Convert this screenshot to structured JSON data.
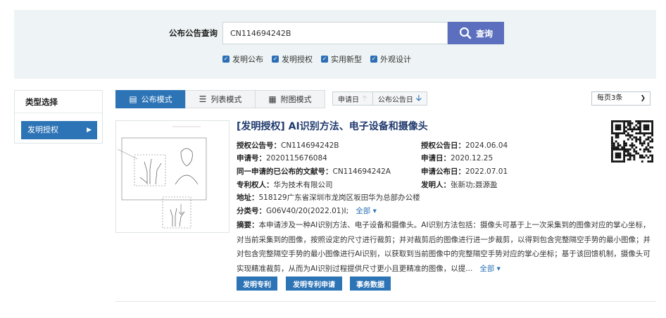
{
  "search": {
    "label": "公布公告查询",
    "value": "CN114694242B",
    "button_label": "查询",
    "filters": [
      {
        "label": "发明公布",
        "checked": true
      },
      {
        "label": "发明授权",
        "checked": true
      },
      {
        "label": "实用新型",
        "checked": true
      },
      {
        "label": "外观设计",
        "checked": true
      }
    ]
  },
  "sidebar": {
    "title": "类型选择",
    "items": [
      {
        "label": "发明授权",
        "active": true
      }
    ]
  },
  "view_tabs": [
    {
      "label": "公布模式",
      "icon": "list-detail-icon",
      "active": true
    },
    {
      "label": "列表模式",
      "icon": "list-icon",
      "active": false
    },
    {
      "label": "附图模式",
      "icon": "grid-icon",
      "active": false
    }
  ],
  "sort": [
    {
      "label": "申请日",
      "direction": "up",
      "active": false
    },
    {
      "label": "公布公告日",
      "direction": "down",
      "active": true
    }
  ],
  "per_page": {
    "value": "每页3条"
  },
  "result": {
    "title": "[发明授权] AI识别方法、电子设备和摄像头",
    "fields": {
      "grant_pub_no": {
        "label": "授权公告号：",
        "value": "CN114694242B"
      },
      "grant_pub_date": {
        "label": "授权公告日：",
        "value": "2024.06.04"
      },
      "app_no": {
        "label": "申请号：",
        "value": "2020115676084"
      },
      "app_date": {
        "label": "申请日：",
        "value": "2020.12.25"
      },
      "same_app": {
        "label": "同一申请的已公布的文献号：",
        "value": "CN114694242A"
      },
      "app_pub_date": {
        "label": "申请公布日：",
        "value": "2022.07.01"
      },
      "patentee": {
        "label": "专利权人：",
        "value": "华为技术有限公司"
      },
      "inventor": {
        "label": "发明人：",
        "value": "张新功;聂源盈"
      },
      "address": {
        "label": "地址：",
        "value": "518129广东省深圳市龙岗区坂田华为总部办公楼"
      },
      "classification": {
        "label": "分类号：",
        "value": "G06V40/20(2022.01)I;"
      }
    },
    "classification_more": "全部",
    "abstract_label": "摘要：",
    "abstract": "本申请涉及一种AI识别方法、电子设备和摄像头。AI识别方法包括：摄像头可基于上一次采集到的图像对应的掌心坐标，对当前采集到的图像，按照设定的尺寸进行裁剪；并对裁剪后的图像进行进一步裁剪，以得到包含完整隔空手势的最小图像；并对包含完整隔空手势的最小图像进行AI识别，以获取到当前图像中的完整隔空手势对应的掌心坐标；基于该回馈机制，摄像头可实现精准裁剪，从而为AI识别过程提供尺寸更小且更精准的图像，以提...",
    "abstract_more": "全部",
    "actions": [
      "发明专利",
      "发明专利申请",
      "事务数据"
    ]
  },
  "colors": {
    "primary": "#2d74b6",
    "search_button": "#5b6fbe",
    "panel_bg": "#eef4f5",
    "title": "#203a6e"
  }
}
